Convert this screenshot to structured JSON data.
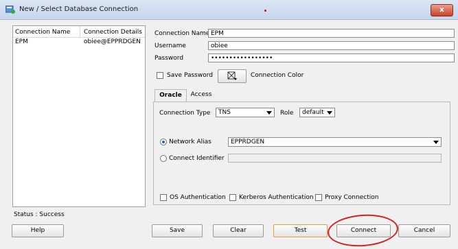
{
  "window": {
    "title": "New / Select Database Connection",
    "close_label": "x"
  },
  "connections_table": {
    "headers": [
      "Connection Name",
      "Connection Details"
    ],
    "rows": [
      {
        "name": "EPM",
        "details": "obiee@EPPRDGEN"
      }
    ]
  },
  "form": {
    "connection_name_label": "Connection Name",
    "connection_name_value": "EPM",
    "username_label": "Username",
    "username_value": "obiee",
    "password_label": "Password",
    "password_value": "•••••••••••••••••",
    "save_password_label": "Save Password",
    "connection_color_label": "Connection Color"
  },
  "tabs": [
    {
      "label": "Oracle",
      "active": true
    },
    {
      "label": "Access",
      "active": false
    }
  ],
  "oracle_tab": {
    "connection_type_label": "Connection Type",
    "connection_type_value": "TNS",
    "role_label": "Role",
    "role_value": "default",
    "network_alias_label": "Network Alias",
    "network_alias_value": "EPPRDGEN",
    "connect_identifier_label": "Connect Identifier",
    "os_auth_label": "OS Authentication",
    "kerberos_auth_label": "Kerberos Authentication",
    "proxy_conn_label": "Proxy Connection"
  },
  "status": "Status : Success",
  "buttons": {
    "help": "Help",
    "save": "Save",
    "clear": "Clear",
    "test": "Test",
    "connect": "Connect",
    "cancel": "Cancel"
  },
  "colors": {
    "accent": "#2d5fbf",
    "annotation_red": "#d41f1f",
    "close_red": "#c7432b"
  }
}
